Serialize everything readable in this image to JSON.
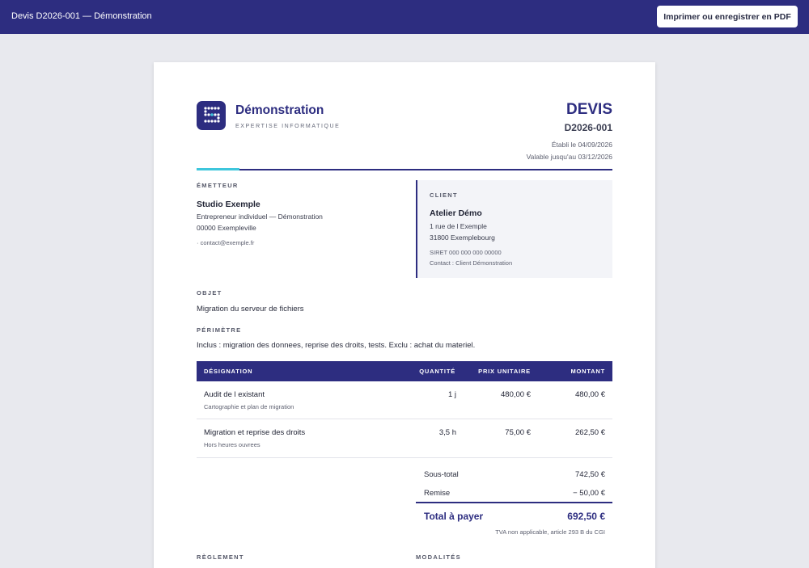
{
  "topbar": {
    "title": "Devis D2026-001 — Démonstration",
    "print_label": "Imprimer ou enregistrer en PDF"
  },
  "colors": {
    "brand": "#2d2d80",
    "accent": "#3ec6dc",
    "background": "#e8e9ee"
  },
  "header": {
    "logo_icon": "dotted-s-logo-icon",
    "company_name": "Démonstration",
    "tagline": "EXPERTISE INFORMATIQUE",
    "doc_type": "DEVIS",
    "doc_number": "D2026-001",
    "issued": "Établi le 04/09/2026",
    "valid_until": "Valable jusqu'au 03/12/2026"
  },
  "emitter": {
    "label": "ÉMETTEUR",
    "name": "Studio Exemple",
    "line1": "Entrepreneur individuel — Démonstration",
    "line2": "00000 Exempleville",
    "contact": "· contact@exemple.fr"
  },
  "client": {
    "label": "CLIENT",
    "name": "Atelier Démo",
    "address1": "1 rue de l Exemple",
    "address2": "31800 Exemplebourg",
    "siret": "SIRET 000 000 000 00000",
    "contact": "Contact : Client Démonstration"
  },
  "object": {
    "label": "OBJET",
    "text": "Migration du serveur de fichiers"
  },
  "scope": {
    "label": "PÉRIMÈTRE",
    "text": "Inclus : migration des donnees, reprise des droits, tests. Exclu : achat du materiel."
  },
  "table": {
    "headers": {
      "designation": "DÉSIGNATION",
      "quantity": "QUANTITÉ",
      "unit_price": "PRIX UNITAIRE",
      "amount": "MONTANT"
    },
    "rows": [
      {
        "title": "Audit de l existant",
        "subtitle": "Cartographie et plan de migration",
        "quantity": "1 j",
        "unit_price": "480,00 €",
        "amount": "480,00 €"
      },
      {
        "title": "Migration et reprise des droits",
        "subtitle": "Hors heures ouvrees",
        "quantity": "3,5 h",
        "unit_price": "75,00 €",
        "amount": "262,50 €"
      }
    ]
  },
  "totals": {
    "subtotal_label": "Sous-total",
    "subtotal_value": "742,50 €",
    "discount_label": "Remise",
    "discount_value": "− 50,00 €",
    "total_label": "Total à payer",
    "total_value": "692,50 €",
    "vat_note": "TVA non applicable, article 293 B du CGI"
  },
  "footer": {
    "payment_label": "RÈGLEMENT",
    "terms_label": "MODALITÉS"
  }
}
